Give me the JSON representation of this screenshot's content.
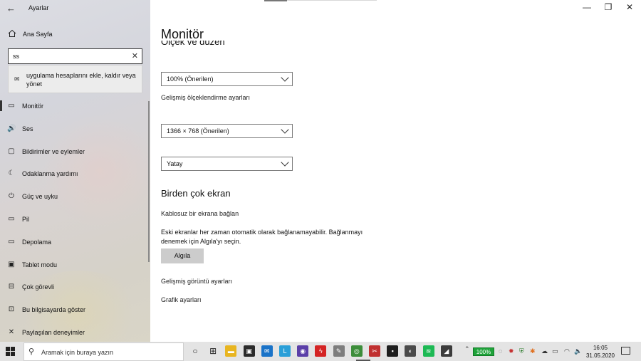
{
  "window": {
    "app_title": "Ayarlar",
    "back_icon": "back-arrow-icon",
    "minimize_glyph": "—",
    "restore_glyph": "❐",
    "close_glyph": "✕"
  },
  "sidebar": {
    "home_label": "Ana Sayfa",
    "search_value": "ss",
    "clear_glyph": "✕",
    "suggestion": "uygulama hesaplarını ekle, kaldır veya yönet",
    "items": [
      {
        "label": "Monitör",
        "icon": "monitor-icon",
        "glyph": "▭",
        "selected": true
      },
      {
        "label": "Ses",
        "icon": "speaker-icon",
        "glyph": "🔊"
      },
      {
        "label": "Bildirimler ve eylemler",
        "icon": "notification-icon",
        "glyph": "▢"
      },
      {
        "label": "Odaklanma yardımı",
        "icon": "moon-icon",
        "glyph": "☾"
      },
      {
        "label": "Güç ve uyku",
        "icon": "power-icon",
        "glyph": "⏻"
      },
      {
        "label": "Pil",
        "icon": "battery-icon",
        "glyph": "▭"
      },
      {
        "label": "Depolama",
        "icon": "storage-icon",
        "glyph": "▭"
      },
      {
        "label": "Tablet modu",
        "icon": "tablet-icon",
        "glyph": "▣"
      },
      {
        "label": "Çok görevli",
        "icon": "multitask-icon",
        "glyph": "⊟"
      },
      {
        "label": "Bu bilgisayarda göster",
        "icon": "project-icon",
        "glyph": "⊡"
      },
      {
        "label": "Paylaşılan deneyimler",
        "icon": "shared-experiences-icon",
        "glyph": "✕"
      }
    ]
  },
  "main": {
    "page_title": "Monitör",
    "cut_heading": "Ölçek ve düzen",
    "scale_value": "100% (Önerilen)",
    "advanced_scaling_link": "Gelişmiş ölçeklendirme ayarları",
    "resolution_value": "1366 × 768 (Önerilen)",
    "orientation_value": "Yatay",
    "multi_display_heading": "Birden çok ekran",
    "wireless_link": "Kablosuz bir ekrana bağlan",
    "desc": "Eski ekranlar her zaman otomatik olarak bağlanamayabilir. Bağlanmayı denemek için Algıla'yı seçin.",
    "detect_button": "Algıla",
    "advanced_display_link": "Gelişmiş görüntü ayarları",
    "graphics_link": "Grafik ayarları"
  },
  "taskbar": {
    "search_placeholder": "Aramak için buraya yazın",
    "battery_percent": "100%",
    "time": "16:05",
    "date": "31.05.2020",
    "apps": [
      {
        "name": "cortana-icon",
        "glyph": "○",
        "color": "transparent"
      },
      {
        "name": "task-view-icon",
        "glyph": "⊞",
        "color": "transparent"
      },
      {
        "name": "file-explorer-icon",
        "glyph": "▬",
        "color": "#e8b520"
      },
      {
        "name": "store-icon",
        "glyph": "▣",
        "color": "#2b2b2b"
      },
      {
        "name": "mail-icon",
        "glyph": "✉",
        "color": "#1a73c8"
      },
      {
        "name": "l-app-icon",
        "glyph": "L",
        "color": "#2a9fd8"
      },
      {
        "name": "purple-app-icon",
        "glyph": "◉",
        "color": "#5b3fa8"
      },
      {
        "name": "flash-icon",
        "glyph": "ϟ",
        "color": "#d42424"
      },
      {
        "name": "tool-icon",
        "glyph": "✎",
        "color": "#7d7d7d"
      },
      {
        "name": "chrome-icon",
        "glyph": "◎",
        "color": "#3c8d3a"
      },
      {
        "name": "snipping-icon",
        "glyph": "✂",
        "color": "#c03030"
      },
      {
        "name": "terminal-icon",
        "glyph": "▪",
        "color": "#1e1e1e"
      },
      {
        "name": "media-icon",
        "glyph": "◐",
        "color": "#4a4a4a"
      },
      {
        "name": "spotify-icon",
        "glyph": "≋",
        "color": "#1db954"
      },
      {
        "name": "misc-app-icon",
        "glyph": "◢",
        "color": "#3c3c3c"
      }
    ]
  }
}
